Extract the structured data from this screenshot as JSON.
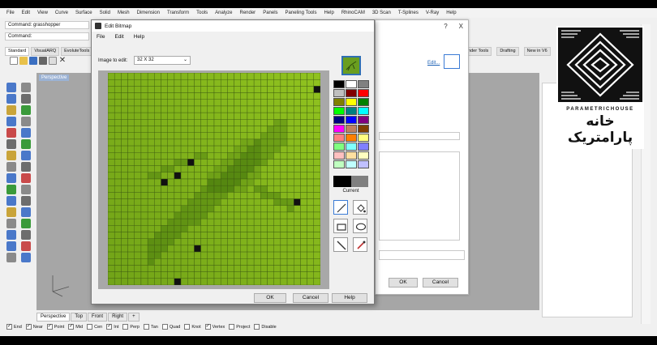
{
  "menubar": [
    "File",
    "Edit",
    "View",
    "Curve",
    "Surface",
    "Solid",
    "Mesh",
    "Dimension",
    "Transform",
    "Tools",
    "Analyze",
    "Render",
    "Panels",
    "Paneling Tools",
    "Help",
    "RhinoCAM",
    "3D Scan",
    "T-Splines",
    "V-Ray",
    "Help"
  ],
  "command_history": "Command: grasshopper",
  "command_prompt": "Command:",
  "toolbar_tabs": [
    "Standard",
    "VisualARQ",
    "EvoluteTools"
  ],
  "right_tabs": [
    "Render Tools",
    "Drafting",
    "New in V6"
  ],
  "viewport": {
    "label": "Perspective"
  },
  "viewport_tabs": [
    "Perspective",
    "Top",
    "Front",
    "Right",
    "+"
  ],
  "osnaps": [
    {
      "label": "End",
      "checked": true
    },
    {
      "label": "Near",
      "checked": true
    },
    {
      "label": "Point",
      "checked": true
    },
    {
      "label": "Mid",
      "checked": true
    },
    {
      "label": "Cen",
      "checked": false
    },
    {
      "label": "Int",
      "checked": true
    },
    {
      "label": "Perp",
      "checked": false
    },
    {
      "label": "Tan",
      "checked": false
    },
    {
      "label": "Quad",
      "checked": false
    },
    {
      "label": "Knot",
      "checked": false
    },
    {
      "label": "Vertex",
      "checked": true
    },
    {
      "label": "Project",
      "checked": false
    },
    {
      "label": "Disable",
      "checked": false
    }
  ],
  "back_dialog": {
    "help_symbol": "?",
    "close_symbol": "X",
    "edit_link": "Edit...",
    "ok_label": "OK",
    "cancel_label": "Cancel"
  },
  "edit_bitmap": {
    "title": "Edit Bitmap",
    "menu": [
      "File",
      "Edit",
      "Help"
    ],
    "image_to_edit_label": "Image to edit:",
    "image_size": "32 X 32",
    "current_label": "Current",
    "ok_label": "OK",
    "cancel_label": "Cancel",
    "help_label": "Help",
    "palette": [
      "#000000",
      "#ffffff",
      "#808080",
      "#c0c0c0",
      "#800000",
      "#ff0000",
      "#808000",
      "#ffff00",
      "#008000",
      "#00ff00",
      "#008080",
      "#00ffff",
      "#000080",
      "#0000ff",
      "#800080",
      "#ff00ff",
      "#c08060",
      "#804000",
      "#ff8080",
      "#ff8000",
      "#ffff80",
      "#80ff80",
      "#80ffff",
      "#8080ff",
      "#ffc0c0",
      "#ffe0a0",
      "#ffffc0",
      "#c0ffc0",
      "#c0ffff",
      "#c0c0ff"
    ],
    "current_colors": [
      "#000000",
      "#808080"
    ],
    "tools": [
      "pencil-icon",
      "fill-icon",
      "rectangle-icon",
      "ellipse-icon",
      "line-icon",
      "eyedropper-icon"
    ]
  },
  "watermark": {
    "brand": "PARAMETRICHOUSE",
    "persian": "خانه پارامتریک"
  }
}
